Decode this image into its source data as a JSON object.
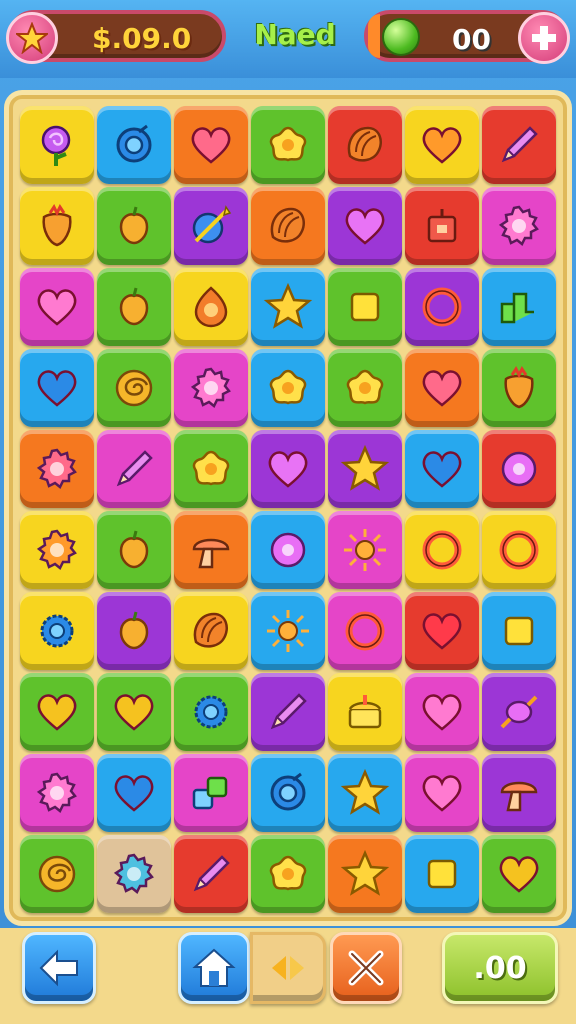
{
  "header": {
    "coins": "$.09.0",
    "title": "Naed",
    "gems": "00"
  },
  "footer": {
    "score": ".00"
  },
  "colors": {
    "yellow": "#f7d51f",
    "blue": "#27a8ee",
    "orange": "#f5781f",
    "green": "#5fc22c",
    "red": "#e63b2e",
    "purple": "#9c36d6",
    "magenta": "#e545c8",
    "tan": "#e0c39a"
  },
  "board": [
    [
      {
        "c": "yellow",
        "i": "lollipop"
      },
      {
        "c": "blue",
        "i": "ring-swirl"
      },
      {
        "c": "orange",
        "i": "heart"
      },
      {
        "c": "green",
        "i": "flower"
      },
      {
        "c": "red",
        "i": "shell"
      },
      {
        "c": "yellow",
        "i": "heart"
      },
      {
        "c": "red",
        "i": "pencil"
      }
    ],
    [
      {
        "c": "yellow",
        "i": "strawberry"
      },
      {
        "c": "green",
        "i": "fruit"
      },
      {
        "c": "purple",
        "i": "wand"
      },
      {
        "c": "orange",
        "i": "shell"
      },
      {
        "c": "purple",
        "i": "heart"
      },
      {
        "c": "red",
        "i": "box"
      },
      {
        "c": "magenta",
        "i": "cog"
      }
    ],
    [
      {
        "c": "magenta",
        "i": "heart"
      },
      {
        "c": "green",
        "i": "fruit"
      },
      {
        "c": "yellow",
        "i": "drop"
      },
      {
        "c": "blue",
        "i": "star"
      },
      {
        "c": "green",
        "i": "square"
      },
      {
        "c": "purple",
        "i": "ring"
      },
      {
        "c": "blue",
        "i": "arrows"
      }
    ],
    [
      {
        "c": "blue",
        "i": "heart"
      },
      {
        "c": "green",
        "i": "swirl"
      },
      {
        "c": "magenta",
        "i": "cog"
      },
      {
        "c": "blue",
        "i": "flower"
      },
      {
        "c": "green",
        "i": "flower"
      },
      {
        "c": "orange",
        "i": "heart"
      },
      {
        "c": "green",
        "i": "strawberry"
      }
    ],
    [
      {
        "c": "orange",
        "i": "cog"
      },
      {
        "c": "magenta",
        "i": "pencil"
      },
      {
        "c": "green",
        "i": "flower"
      },
      {
        "c": "purple",
        "i": "heart"
      },
      {
        "c": "purple",
        "i": "star"
      },
      {
        "c": "blue",
        "i": "heart"
      },
      {
        "c": "red",
        "i": "disc"
      }
    ],
    [
      {
        "c": "yellow",
        "i": "cog"
      },
      {
        "c": "green",
        "i": "fruit"
      },
      {
        "c": "orange",
        "i": "mushroom"
      },
      {
        "c": "blue",
        "i": "disc"
      },
      {
        "c": "magenta",
        "i": "sun"
      },
      {
        "c": "yellow",
        "i": "ring"
      },
      {
        "c": "yellow",
        "i": "ring"
      }
    ],
    [
      {
        "c": "yellow",
        "i": "gear"
      },
      {
        "c": "purple",
        "i": "fruit"
      },
      {
        "c": "yellow",
        "i": "shell"
      },
      {
        "c": "blue",
        "i": "sun"
      },
      {
        "c": "magenta",
        "i": "ring"
      },
      {
        "c": "red",
        "i": "heart"
      },
      {
        "c": "blue",
        "i": "square"
      }
    ],
    [
      {
        "c": "green",
        "i": "heart"
      },
      {
        "c": "green",
        "i": "heart"
      },
      {
        "c": "green",
        "i": "gear"
      },
      {
        "c": "purple",
        "i": "pencil"
      },
      {
        "c": "yellow",
        "i": "cake"
      },
      {
        "c": "magenta",
        "i": "heart"
      },
      {
        "c": "purple",
        "i": "candy"
      }
    ],
    [
      {
        "c": "magenta",
        "i": "cog"
      },
      {
        "c": "blue",
        "i": "heart"
      },
      {
        "c": "magenta",
        "i": "blocks"
      },
      {
        "c": "blue",
        "i": "ring-swirl"
      },
      {
        "c": "blue",
        "i": "star"
      },
      {
        "c": "magenta",
        "i": "heart"
      },
      {
        "c": "purple",
        "i": "mushroom"
      }
    ],
    [
      {
        "c": "green",
        "i": "swirl"
      },
      {
        "c": "tan",
        "i": "cog"
      },
      {
        "c": "red",
        "i": "pencil"
      },
      {
        "c": "green",
        "i": "flower"
      },
      {
        "c": "orange",
        "i": "star"
      },
      {
        "c": "blue",
        "i": "square"
      },
      {
        "c": "green",
        "i": "heart"
      }
    ]
  ]
}
